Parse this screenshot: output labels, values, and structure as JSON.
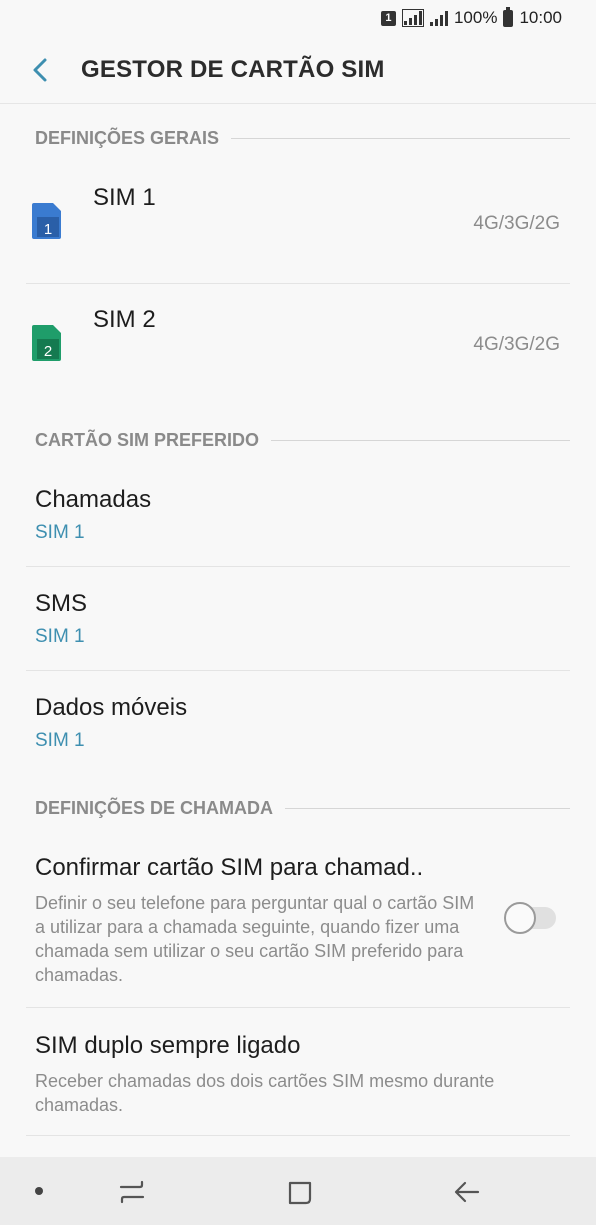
{
  "status_bar": {
    "sim_indicator": "1",
    "battery_percent": "100%",
    "time": "10:00",
    "icons": [
      "sim-1-icon",
      "signal-icon",
      "signal-icon",
      "battery-icon"
    ]
  },
  "header": {
    "title": "GESTOR DE CARTÃO SIM",
    "back_icon": "chevron-left-icon"
  },
  "sections": {
    "general": "DEFINIÇÕES GERAIS",
    "preferred": "CARTÃO SIM PREFERIDO",
    "call_settings": "DEFINIÇÕES DE CHAMADA"
  },
  "sims": [
    {
      "name": "SIM 1",
      "network": "4G/3G/2G",
      "icon_number": "1",
      "color": "#3a7bd0"
    },
    {
      "name": "SIM 2",
      "network": "4G/3G/2G",
      "icon_number": "2",
      "color": "#1f9d6a"
    }
  ],
  "preferred": [
    {
      "title": "Chamadas",
      "value": "SIM 1"
    },
    {
      "title": "SMS",
      "value": "SIM 1"
    },
    {
      "title": "Dados móveis",
      "value": "SIM 1"
    }
  ],
  "call_settings": [
    {
      "title": "Confirmar cartão SIM para chamad..",
      "description": "Definir o seu telefone para perguntar qual o cartão SIM a utilizar para a chamada seguinte, quando fizer uma chamada sem utilizar o seu cartão SIM preferido para chamadas.",
      "toggle_on": false
    },
    {
      "title": "SIM duplo sempre ligado",
      "description": "Receber chamadas dos dois cartões SIM mesmo durante chamadas."
    }
  ],
  "nav_bar": {
    "icons": [
      "dot-icon",
      "recents-icon",
      "home-icon",
      "back-arrow-icon"
    ]
  },
  "colors": {
    "accent": "#3e8fb0",
    "background": "#f8f8f8"
  }
}
